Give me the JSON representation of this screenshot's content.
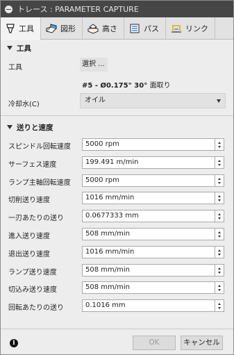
{
  "window": {
    "title": "トレース : PARAMETER CAPTURE"
  },
  "tabs": [
    {
      "label": "工具",
      "icon": "tool-icon"
    },
    {
      "label": "図形",
      "icon": "geometry-icon"
    },
    {
      "label": "高さ",
      "icon": "heights-icon"
    },
    {
      "label": "パス",
      "icon": "passes-icon"
    },
    {
      "label": "リンク",
      "icon": "linking-icon"
    }
  ],
  "tool_section": {
    "header": "工具",
    "tool_label": "工具",
    "select_button": "選択 ...",
    "tool_description": "#5 - Ø0.175\" 30°",
    "tool_description_suffix": "面取り",
    "coolant_label": "冷却水(C)",
    "coolant_value": "オイル"
  },
  "feed_section": {
    "header": "送りと速度",
    "rows": [
      {
        "label": "スピンドル回転速度",
        "value": "5000 rpm"
      },
      {
        "label": "サーフェス速度",
        "value": "199.491 m/min"
      },
      {
        "label": "ランプ主軸回転速度",
        "value": "5000 rpm"
      },
      {
        "label": "切削送り速度",
        "value": "1016 mm/min"
      },
      {
        "label": "一刃あたりの送り",
        "value": "0.0677333 mm"
      },
      {
        "label": "進入送り速度",
        "value": "508 mm/min"
      },
      {
        "label": "退出送り速度",
        "value": "1016 mm/min"
      },
      {
        "label": "ランプ送り速度",
        "value": "508 mm/min"
      },
      {
        "label": "切込み送り速度",
        "value": "508 mm/min"
      },
      {
        "label": "回転あたりの送り",
        "value": "0.1016 mm"
      }
    ]
  },
  "footer": {
    "ok_label": "OK",
    "cancel_label": "キャンセル"
  }
}
